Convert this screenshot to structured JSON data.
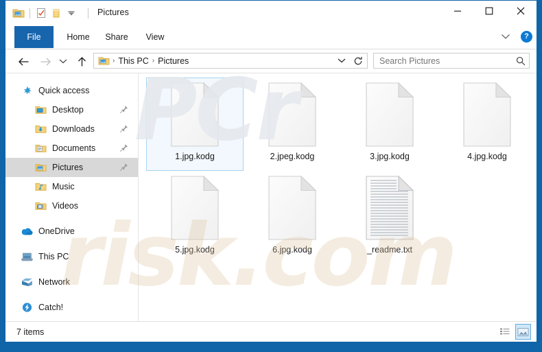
{
  "window": {
    "title": "Pictures",
    "minimize_label": "–",
    "maximize_label": "□",
    "close_label": "✕"
  },
  "quick_access_toolbar": {
    "items": [
      {
        "name": "folder-picture-icon",
        "label": "Pictures properties"
      },
      {
        "name": "properties-icon",
        "label": "Properties"
      },
      {
        "name": "new-folder-icon",
        "label": "New folder"
      },
      {
        "name": "customize-chevron-icon",
        "label": "Customize Quick Access Toolbar"
      }
    ]
  },
  "ribbon": {
    "tabs": [
      {
        "label": "File",
        "selected": true
      },
      {
        "label": "Home",
        "selected": false
      },
      {
        "label": "Share",
        "selected": false
      },
      {
        "label": "View",
        "selected": false
      }
    ],
    "expand_label": "⌄",
    "help_label": "?"
  },
  "navigation": {
    "back_label": "←",
    "forward_label": "→",
    "recent_label": "⌄",
    "up_label": "↑",
    "breadcrumb": [
      "This PC",
      "Pictures"
    ],
    "separator": "›",
    "dropdown_label": "⌄",
    "refresh_label": "↻"
  },
  "search": {
    "placeholder": "Search Pictures",
    "value": "",
    "icon": "search-icon"
  },
  "sidebar": {
    "items": [
      {
        "label": "Quick access",
        "icon": "star-icon",
        "indent": false,
        "pinned": false,
        "selected": false
      },
      {
        "label": "Desktop",
        "icon": "folder-desktop-icon",
        "indent": true,
        "pinned": true,
        "selected": false
      },
      {
        "label": "Downloads",
        "icon": "folder-downloads-icon",
        "indent": true,
        "pinned": true,
        "selected": false
      },
      {
        "label": "Documents",
        "icon": "folder-documents-icon",
        "indent": true,
        "pinned": true,
        "selected": false
      },
      {
        "label": "Pictures",
        "icon": "folder-pictures-icon",
        "indent": true,
        "pinned": true,
        "selected": true
      },
      {
        "label": "Music",
        "icon": "folder-music-icon",
        "indent": true,
        "pinned": false,
        "selected": false
      },
      {
        "label": "Videos",
        "icon": "folder-videos-icon",
        "indent": true,
        "pinned": false,
        "selected": false
      },
      {
        "label": "OneDrive",
        "icon": "onedrive-icon",
        "indent": false,
        "pinned": false,
        "selected": false,
        "gap_before": true
      },
      {
        "label": "This PC",
        "icon": "this-pc-icon",
        "indent": false,
        "pinned": false,
        "selected": false,
        "gap_before": true
      },
      {
        "label": "Network",
        "icon": "network-icon",
        "indent": false,
        "pinned": false,
        "selected": false,
        "gap_before": true
      },
      {
        "label": "Catch!",
        "icon": "catch-icon",
        "indent": false,
        "pinned": false,
        "selected": false,
        "gap_before": true
      }
    ]
  },
  "files": [
    {
      "name": "1.jpg.kodg",
      "icon": "blank-file-icon",
      "selected": true
    },
    {
      "name": "2.jpeg.kodg",
      "icon": "blank-file-icon",
      "selected": false
    },
    {
      "name": "3.jpg.kodg",
      "icon": "blank-file-icon",
      "selected": false
    },
    {
      "name": "4.jpg.kodg",
      "icon": "blank-file-icon",
      "selected": false
    },
    {
      "name": "5.jpg.kodg",
      "icon": "blank-file-icon",
      "selected": false
    },
    {
      "name": "6.jpg.kodg",
      "icon": "blank-file-icon",
      "selected": false
    },
    {
      "name": "_readme.txt",
      "icon": "text-file-icon",
      "selected": false
    }
  ],
  "statusbar": {
    "item_count_text": "7 items",
    "view_buttons": [
      {
        "name": "details-view-button",
        "active": false
      },
      {
        "name": "large-icons-view-button",
        "active": true
      }
    ]
  },
  "watermark": {
    "lower_text": "risk.com",
    "upper_text": "PCr",
    "lower_color": "#dec4a0",
    "upper_color": "#e4e8ec"
  },
  "colors": {
    "window_border": "#1064a8",
    "file_tab": "#1765ad",
    "selection_bg": "#f2f8fd",
    "selection_border": "#a8d3f0",
    "sidebar_selected": "#d8d8d8",
    "help_blue": "#0d7ad4"
  }
}
